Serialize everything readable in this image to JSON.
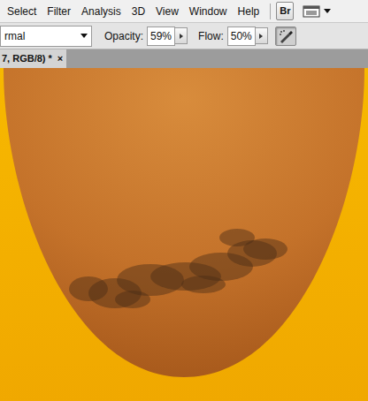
{
  "menu": [
    "Select",
    "Filter",
    "Analysis",
    "3D",
    "View",
    "Window",
    "Help"
  ],
  "toolbar": {
    "bridge": "Br"
  },
  "options": {
    "blend_mode": "rmal",
    "opacity": {
      "label": "Opacity:",
      "value": "59%"
    },
    "flow": {
      "label": "Flow:",
      "value": "50%"
    },
    "airbrush": {
      "on": true
    }
  },
  "document_tab": {
    "title": "7, RGB/8) *",
    "close": "×"
  }
}
